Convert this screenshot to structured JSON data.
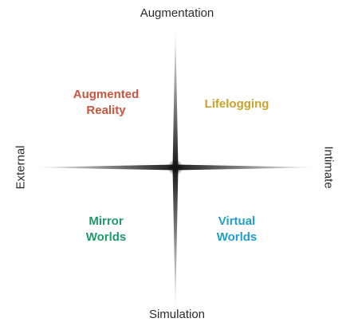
{
  "axes": {
    "top": "Augmentation",
    "bottom": "Simulation",
    "left": "External",
    "right": "Intimate"
  },
  "quadrants": [
    {
      "label": "Augmented\nReality",
      "color": "#c8553d"
    },
    {
      "label": "Lifelogging",
      "color": "#c9a227"
    },
    {
      "label": "Mirror\nWorlds",
      "color": "#1f9a6b"
    },
    {
      "label": "Virtual\nWorlds",
      "color": "#1f9fc9"
    }
  ],
  "colors": {
    "axis": "#1a1a1a",
    "axis_label": "#2b2b2b"
  }
}
